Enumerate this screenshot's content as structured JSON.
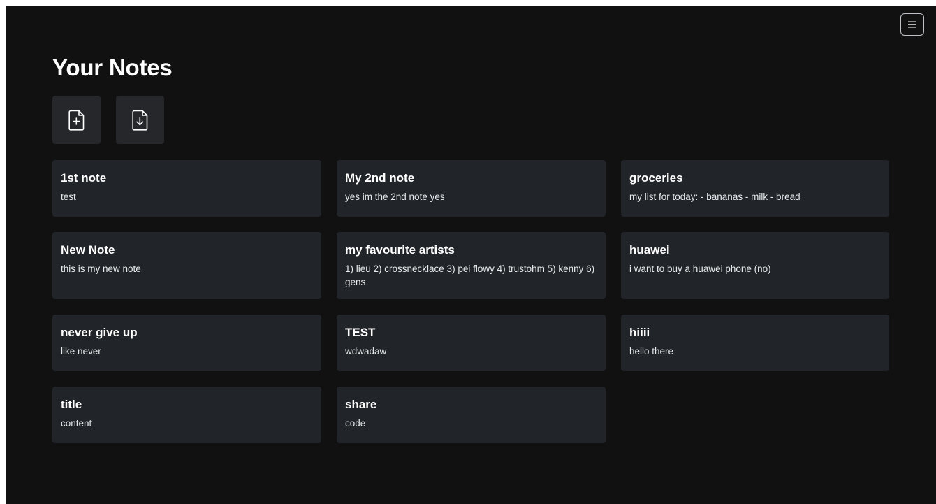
{
  "header": {
    "title": "Your Notes"
  },
  "menu": {
    "icon": "hamburger-menu-icon"
  },
  "actions": [
    {
      "name": "new-note-button",
      "icon": "file-plus-icon"
    },
    {
      "name": "import-note-button",
      "icon": "file-download-icon"
    }
  ],
  "notes": [
    {
      "title": "1st note",
      "content": "test"
    },
    {
      "title": "My 2nd note",
      "content": "yes im the 2nd note yes"
    },
    {
      "title": "groceries",
      "content": "my list for today: - bananas - milk - bread"
    },
    {
      "title": "New Note",
      "content": "this is my new note"
    },
    {
      "title": "my favourite artists",
      "content": "1) lieu 2) crossnecklace 3) pei flowy 4) trustohm 5) kenny 6) gens"
    },
    {
      "title": "huawei",
      "content": "i want to buy a huawei phone (no)"
    },
    {
      "title": "never give up",
      "content": "like never"
    },
    {
      "title": "TEST",
      "content": "wdwadaw"
    },
    {
      "title": "hiiii",
      "content": "hello there"
    },
    {
      "title": "title",
      "content": "content"
    },
    {
      "title": "share",
      "content": "code"
    }
  ],
  "colors": {
    "background": "#111112",
    "card": "#212529",
    "action_button": "#25272a",
    "text": "#ffffff"
  }
}
